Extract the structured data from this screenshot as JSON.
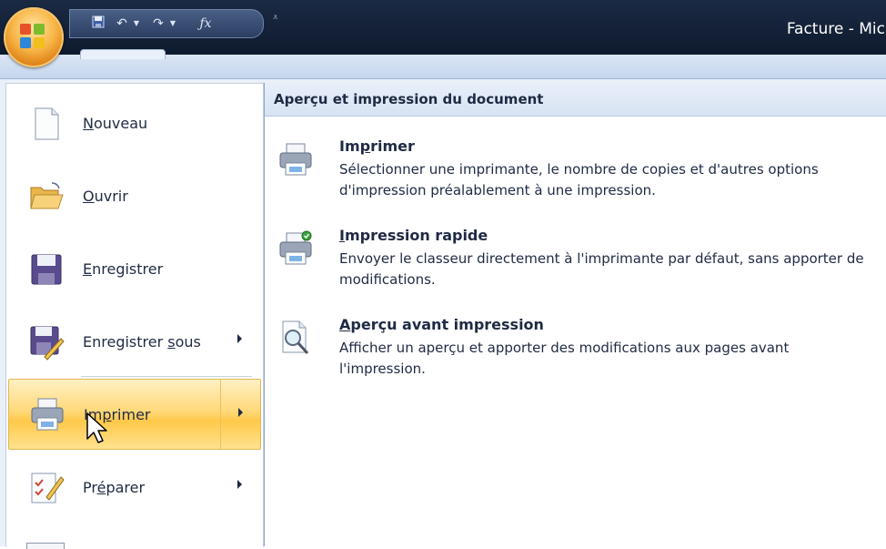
{
  "window": {
    "title": "Facture - Micr"
  },
  "quick_access": {
    "items": [
      "save-icon",
      "undo-icon",
      "redo-icon",
      "function-icon"
    ],
    "more_glyph": "⩡"
  },
  "file_menu": {
    "items": [
      {
        "id": "nouveau",
        "label_pre": "",
        "label_u": "N",
        "label_post": "ouveau",
        "icon": "new-document-icon",
        "has_submenu": false
      },
      {
        "id": "ouvrir",
        "label_pre": "",
        "label_u": "O",
        "label_post": "uvrir",
        "icon": "open-folder-icon",
        "has_submenu": false
      },
      {
        "id": "enregistrer",
        "label_pre": "",
        "label_u": "E",
        "label_post": "nregistrer",
        "icon": "save-icon",
        "has_submenu": false
      },
      {
        "id": "enregistrer-sous",
        "label_pre": "Enregistrer ",
        "label_u": "s",
        "label_post": "ous",
        "icon": "save-as-icon",
        "has_submenu": true
      },
      {
        "id": "imprimer",
        "label_pre": "Im",
        "label_u": "p",
        "label_post": "rimer",
        "icon": "printer-icon",
        "has_submenu": true,
        "active": true
      },
      {
        "id": "preparer",
        "label_pre": "Pr",
        "label_u": "é",
        "label_post": "parer",
        "icon": "prepare-pencil-icon",
        "has_submenu": true
      }
    ]
  },
  "print_panel": {
    "heading": "Aperçu et impression du document",
    "options": [
      {
        "title_pre": "Im",
        "title_u": "p",
        "title_post": "rimer",
        "description": "Sélectionner une imprimante, le nombre de copies et d'autres options d'impression préalablement à une impression.",
        "icon": "printer-icon"
      },
      {
        "title_pre": "",
        "title_u": "I",
        "title_post": "mpression rapide",
        "description": "Envoyer le classeur directement à l'imprimante par défaut, sans apporter de modifications.",
        "icon": "quick-print-icon"
      },
      {
        "title_pre": "",
        "title_u": "A",
        "title_post": "perçu avant impression",
        "description": "Afficher un aperçu et apporter des modifications aux pages avant l'impression.",
        "icon": "print-preview-icon"
      }
    ]
  },
  "colors": {
    "titlebar": "#132036",
    "menu_highlight": "#ffd97a",
    "panel_header": "#d7e3f3",
    "text": "#1f2a44"
  }
}
